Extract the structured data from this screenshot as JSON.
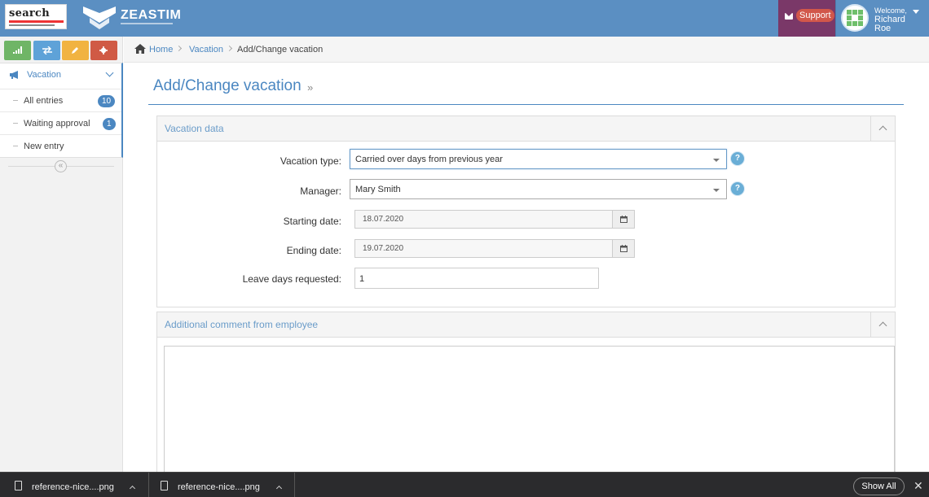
{
  "header": {
    "logo_left": "search",
    "logo_right": "ZEASTIM",
    "support_label": "Support",
    "welcome_label": "Welcome,",
    "user_name": "Richard Roe",
    "colors": {
      "navbar": "#5b8fc2",
      "support_bg": "#7a3868",
      "badge": "#d1574a"
    }
  },
  "shortcuts": [
    {
      "icon": "signal-icon",
      "color": "#6fb566"
    },
    {
      "icon": "exchange-icon",
      "color": "#5ea2d8"
    },
    {
      "icon": "pencil-icon",
      "color": "#f1b341"
    },
    {
      "icon": "gear-icon",
      "color": "#d05a45"
    }
  ],
  "sidebar": {
    "section_label": "Vacation",
    "items": [
      {
        "label": "All entries",
        "badge": "10"
      },
      {
        "label": "Waiting approval",
        "badge": "1"
      },
      {
        "label": "New entry",
        "badge": ""
      }
    ],
    "collapse_glyph": "«"
  },
  "breadcrumb": {
    "home": "Home",
    "vacation": "Vacation",
    "current": "Add/Change vacation"
  },
  "page": {
    "title": "Add/Change vacation",
    "title_suffix": "»"
  },
  "vacation_panel": {
    "title": "Vacation data",
    "type_label": "Vacation type:",
    "type_value": "Carried over days from previous year",
    "manager_label": "Manager:",
    "manager_value": "Mary Smith",
    "start_label": "Starting date:",
    "start_value": "18.07.2020",
    "end_label": "Ending date:",
    "end_value": "19.07.2020",
    "days_label": "Leave days requested:",
    "days_value": "1",
    "help_glyph": "?"
  },
  "comment_panel": {
    "title": "Additional comment from employee"
  },
  "downloads": {
    "items": [
      "reference-nice....png",
      "reference-nice....png"
    ],
    "show_all": "Show All",
    "close_glyph": "✕"
  }
}
